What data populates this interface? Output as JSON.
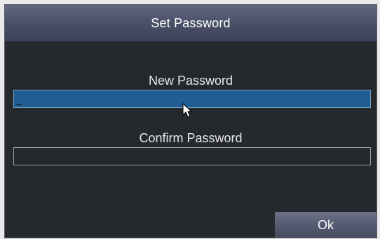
{
  "dialog": {
    "title": "Set Password",
    "new_password": {
      "label": "New Password",
      "value": ""
    },
    "confirm_password": {
      "label": "Confirm Password",
      "value": ""
    },
    "ok_label": "Ok"
  },
  "colors": {
    "title_bar": "#4a5068",
    "dialog_background": "#25282d",
    "focused_field": "#1f5d92",
    "button": "#545a70"
  },
  "icons": {
    "cursor": "mouse-pointer-icon"
  }
}
